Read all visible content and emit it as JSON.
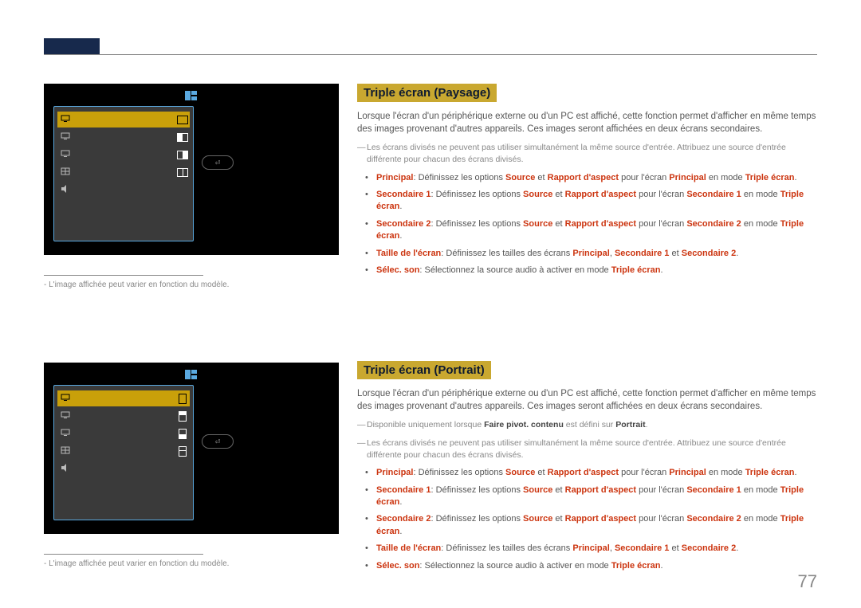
{
  "page_number": "77",
  "caption": "L'image affichée peut varier en fonction du modèle.",
  "sections": {
    "paysage": {
      "title": "Triple écran (Paysage)",
      "intro": "Lorsque l'écran d'un périphérique externe ou d'un PC est affiché, cette fonction permet d'afficher en même temps des images provenant d'autres appareils. Ces images seront affichées en deux écrans secondaires.",
      "notes": [
        "Les écrans divisés ne peuvent pas utiliser simultanément la même source d'entrée. Attribuez une source d'entrée différente pour chacun des écrans divisés."
      ]
    },
    "portrait": {
      "title": "Triple écran (Portrait)",
      "intro": "Lorsque l'écran d'un périphérique externe ou d'un PC est affiché, cette fonction permet d'afficher en même temps des images provenant d'autres appareils. Ces images seront affichées en deux écrans secondaires.",
      "notes": [
        "Disponible uniquement lorsque Faire pivot. contenu est défini sur Portrait.",
        "Les écrans divisés ne peuvent pas utiliser simultanément la même source d'entrée. Attribuez une source d'entrée différente pour chacun des écrans divisés."
      ]
    }
  },
  "bullets": {
    "principal_pre": "Principal",
    "principal_post": ": Définissez les options ",
    "source": "Source",
    "et": " et ",
    "rapport": "Rapport d'aspect",
    "pour_principal": " pour l'écran ",
    "en_mode": " en mode ",
    "triple_ecran": "Triple écran",
    "secondaire1": "Secondaire 1",
    "secondaire2": "Secondaire 2",
    "taille_label": "Taille de l'écran",
    "taille_post": ": Définissez les tailles des écrans ",
    "virg": ", ",
    "et_word": " et ",
    "period": ".",
    "selec_label": "Sélec. son",
    "selec_post": ": Sélectionnez la source audio à activer en mode "
  },
  "note_portrait_pre": "Disponible uniquement lorsque ",
  "note_portrait_bold": "Faire pivot. contenu",
  "note_portrait_mid": " est défini sur ",
  "note_portrait_bold2": "Portrait",
  "menu": {
    "return": "⏎"
  }
}
